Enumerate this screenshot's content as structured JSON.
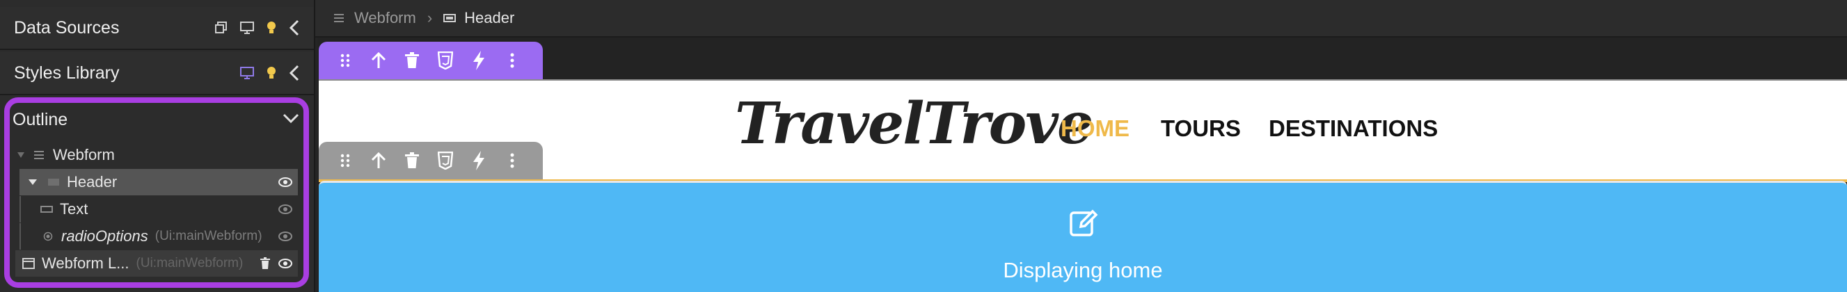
{
  "left_panel": {
    "data_sources": {
      "title": "Data Sources"
    },
    "styles_library": {
      "title": "Styles Library"
    },
    "outline": {
      "title": "Outline",
      "tree": [
        {
          "label": "Webform",
          "hint": ""
        },
        {
          "label": "Header",
          "hint": ""
        },
        {
          "label": "Text",
          "hint": ""
        },
        {
          "label": "radioOptions",
          "hint": "(Ui:mainWebform)"
        },
        {
          "label": "Webform L...",
          "hint": "(Ui:mainWebform)"
        }
      ]
    }
  },
  "breadcrumb": {
    "root": "Webform",
    "current": "Header"
  },
  "header": {
    "logo": "TravelTrove",
    "nav": [
      "HOME",
      "TOURS",
      "DESTINATIONS"
    ],
    "active_color": "#efb94a"
  },
  "content": {
    "message": "Displaying home"
  },
  "colors": {
    "outline_highlight": "#a93ee2",
    "toolbar_active": "#9b6bf2",
    "toolbar_inactive": "#9a9a9a",
    "content_bg": "#4fb8f5"
  },
  "icons": {
    "toolbar": [
      "drag-handle-icon",
      "move-up-icon",
      "trash-icon",
      "css-icon",
      "event-bolt-icon",
      "more-vertical-icon"
    ]
  }
}
